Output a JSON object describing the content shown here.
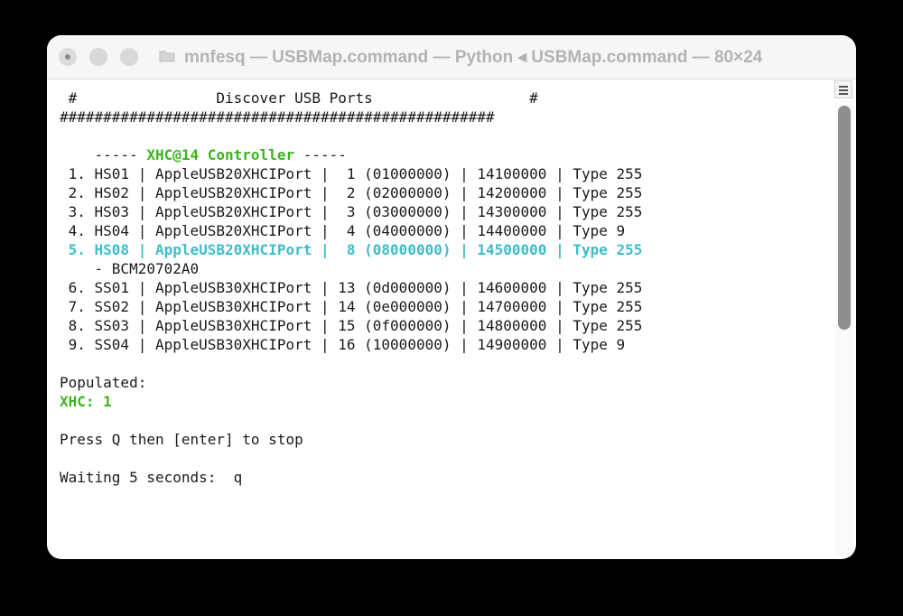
{
  "window": {
    "title": "mnfesq — USBMap.command — Python ◂ USBMap.command — 80×24",
    "icons": {
      "folder": "folder-icon",
      "scroll_button": "split-pane-icon"
    }
  },
  "terminal": {
    "header_line": " #                Discover USB Ports                  #",
    "hash_line": "##################################################",
    "controller_prefix": "    ----- ",
    "controller_name": "XHC@14 Controller",
    "controller_suffix": " -----",
    "ports": [
      " 1. HS01 | AppleUSB20XHCIPort |  1 (01000000) | 14100000 | Type 255",
      " 2. HS02 | AppleUSB20XHCIPort |  2 (02000000) | 14200000 | Type 255",
      " 3. HS03 | AppleUSB20XHCIPort |  3 (03000000) | 14300000 | Type 255",
      " 4. HS04 | AppleUSB20XHCIPort |  4 (04000000) | 14400000 | Type 9",
      " 5. HS08 | AppleUSB20XHCIPort |  8 (08000000) | 14500000 | Type 255",
      "    - BCM20702A0",
      " 6. SS01 | AppleUSB30XHCIPort | 13 (0d000000) | 14600000 | Type 255",
      " 7. SS02 | AppleUSB30XHCIPort | 14 (0e000000) | 14700000 | Type 255",
      " 8. SS03 | AppleUSB30XHCIPort | 15 (0f000000) | 14800000 | Type 255",
      " 9. SS04 | AppleUSB30XHCIPort | 16 (10000000) | 14900000 | Type 9"
    ],
    "populated_label": "Populated:",
    "populated_value": "XHC: 1",
    "stop_prompt": "Press Q then [enter] to stop",
    "waiting_text": "Waiting 5 seconds:  q",
    "colors": {
      "green": "#3cb520",
      "highlight": "#3fbcc7",
      "text": "#1a1a1a"
    }
  }
}
